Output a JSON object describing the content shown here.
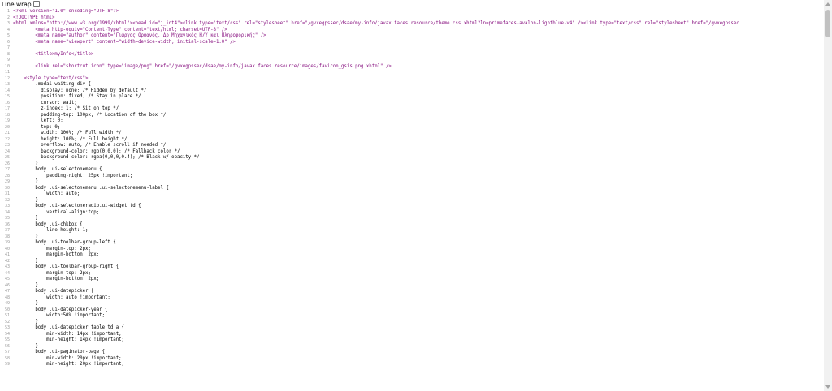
{
  "toolbar": {
    "line_wrap_label": "Line wrap"
  },
  "lines": [
    "<?xml version=\"1.0\" encoding=\"UTF-8\"?>",
    "<!DOCTYPE html>",
    "<html xmlns=\"http://www.w3.org/1999/xhtml\"><head id=\"j_idt4\"><link type=\"text/css\" rel=\"stylesheet\" href=\"/gvxegpssec/dsae/my-info/javax.faces.resource/theme.css.xhtml?ln=primefaces-avalon-lightblue-v4\" /><link type=\"text/css\" rel=\"stylesheet\" href=\"/gvxegpssec",
    "        <meta http-equiv=\"Content-Type\" content=\"text/html; charset=UTF-8\" />",
    "        <meta name=\"author\" content=\"Γιώργος Ορφανός, Δρ Μηχανικός Η/Υ και Πληροφορικής\" />",
    "        <meta name=\"viewport\" content=\"width=device-width, initial-scale=1.0\" />",
    "",
    "        <title>myInfo</title>",
    "",
    "        <link rel=\"shortcut icon\" type=\"image/png\" href=\"/gvxegpssec/dsae/my-info/javax.faces.resource/images/favicon_gsis.png.xhtml\" />",
    "",
    "    <style type=\"text/css\">",
    "        .modal-waiting-div {",
    "          display: none; /* Hidden by default */",
    "          position: fixed; /* Stay in place */",
    "          cursor: wait;",
    "          z-index: 1; /* Sit on top */",
    "          padding-top: 100px; /* Location of the box */",
    "          left: 0;",
    "          top: 0;",
    "          width: 100%; /* Full width */",
    "          height: 100%; /* Full height */",
    "          overflow: auto; /* Enable scroll if needed */",
    "          background-color: rgb(0,0,0); /* Fallback color */",
    "          background-color: rgba(0,0,0,0.4); /* Black w/ opacity */",
    "        }",
    "        body .ui-selectonemenu {",
    "            padding-right: 25px !important;",
    "        }",
    "        body .ui-selectonemenu .ui-selectonemenu-label {",
    "            width: auto;",
    "        }",
    "        body .ui-selectoneradio.ui-widget td {",
    "            vertical-align:top;",
    "        }",
    "        body .ui-chkbox {",
    "            line-height: 1;",
    "        }",
    "        body .ui-toolbar-group-left {",
    "            margin-top: 2px;",
    "            margin-bottom: 2px;",
    "        }",
    "        body .ui-toolbar-group-right {",
    "            margin-top: 2px;",
    "            margin-bottom: 2px;",
    "        }",
    "        body .ui-datepicker {",
    "            width: auto !important;",
    "        }",
    "        body .ui-datepicker-year {",
    "            width:50% !important;",
    "        }",
    "        body .ui-datepicker table td a {",
    "            min-width: 14px !important;",
    "            min-height: 14px !important;",
    "        }",
    "        body .ui-paginator-page {",
    "            min-width: 20px !important;",
    "            min-height: 20px !important;"
  ]
}
